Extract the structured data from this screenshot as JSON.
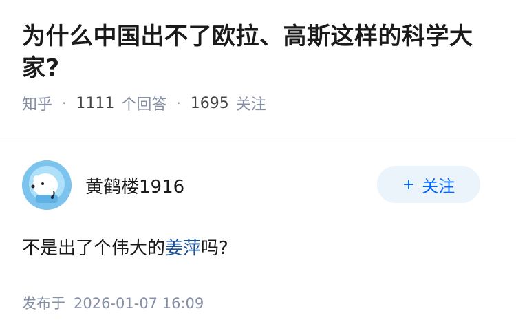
{
  "question": {
    "title": "为什么中国出不了欧拉、高斯这样的科学大家?",
    "source": "知乎",
    "answer_count": "1111",
    "answer_label": "个回答",
    "follow_count": "1695",
    "follow_label": "关注"
  },
  "answer": {
    "author_name": "黄鹤楼1916",
    "follow_button_plus": "+",
    "follow_button_label": "关注",
    "text_before": "不是出了个伟大的",
    "text_link": "姜萍",
    "text_after": "吗?",
    "posted_label": "发布于",
    "posted_date": "2026-01-07 16:09"
  },
  "colors": {
    "link": "#175199",
    "accent": "#0066ff",
    "meta": "#8590a6",
    "follow_bg": "#ebf3fb",
    "avatar_bg": "#7cc3ee"
  }
}
